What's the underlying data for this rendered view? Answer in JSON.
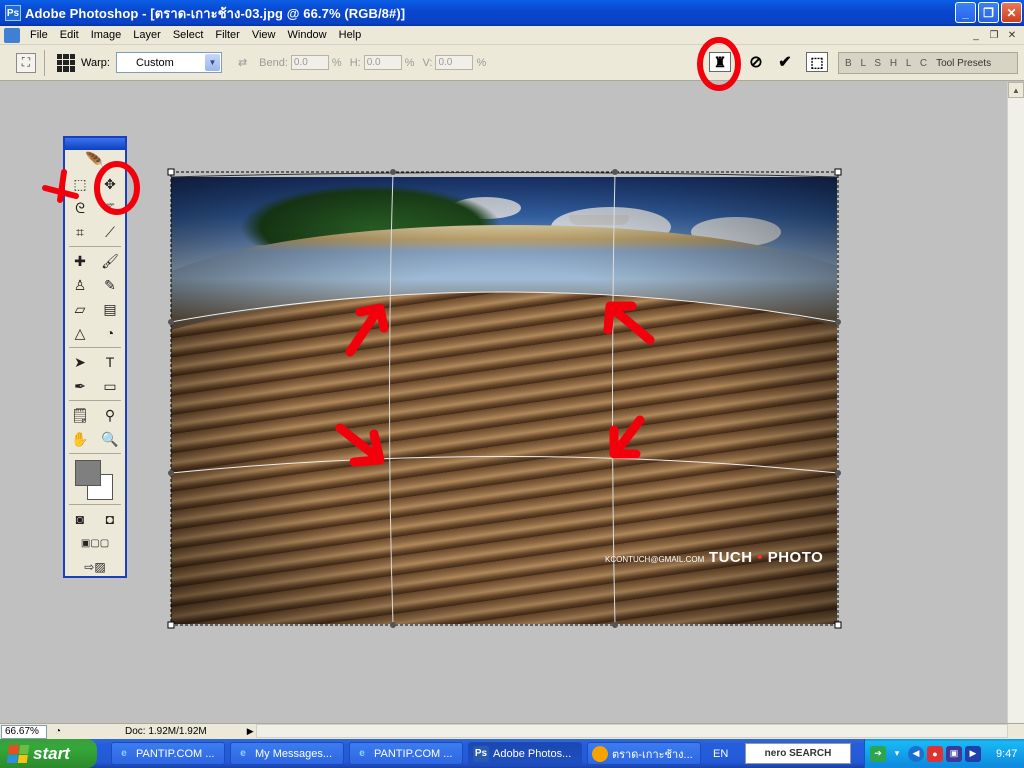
{
  "window": {
    "title": "Adobe Photoshop - [ตราด-เกาะช้าง-03.jpg @ 66.7% (RGB/8#)]",
    "minimize": "_",
    "maximize": "❐",
    "close": "✕"
  },
  "menu": {
    "items": [
      "File",
      "Edit",
      "Image",
      "Layer",
      "Select",
      "Filter",
      "View",
      "Window",
      "Help"
    ]
  },
  "options": {
    "warp_label": "Warp:",
    "warp_value": "Custom",
    "bend_label": "Bend:",
    "bend_value": "0.0",
    "h_label": "H:",
    "h_value": "0.0",
    "v_label": "V:",
    "v_value": "0.0",
    "percent": "%",
    "tool_presets": "Tool Presets",
    "palette_bars": "B L S H L C"
  },
  "canvas": {
    "watermark_small": "KCONTUCH@GMAIL.COM",
    "watermark_big": "TUCH",
    "watermark_photo": "PHOTO"
  },
  "status": {
    "zoom": "66.67%",
    "doc": "Doc: 1.92M/1.92M"
  },
  "taskbar": {
    "start": "start",
    "tasks": [
      {
        "label": "PANTIP.COM ...",
        "icon": "ie-icon"
      },
      {
        "label": "My Messages...",
        "icon": "ie-icon"
      },
      {
        "label": "PANTIP.COM ...",
        "icon": "ie-icon"
      },
      {
        "label": "Adobe Photos...",
        "icon": "photoshop-icon"
      },
      {
        "label": "ตราด-เกาะช้าง...",
        "icon": "image-viewer-icon"
      }
    ],
    "language": "EN",
    "search": "nero SEARCH",
    "clock": "9:47"
  },
  "colors": {
    "annotation": "#f2000c",
    "titlebar": "#0a48d0",
    "foreground_swatch": "#7f7f7f",
    "background_swatch": "#ffffff"
  }
}
